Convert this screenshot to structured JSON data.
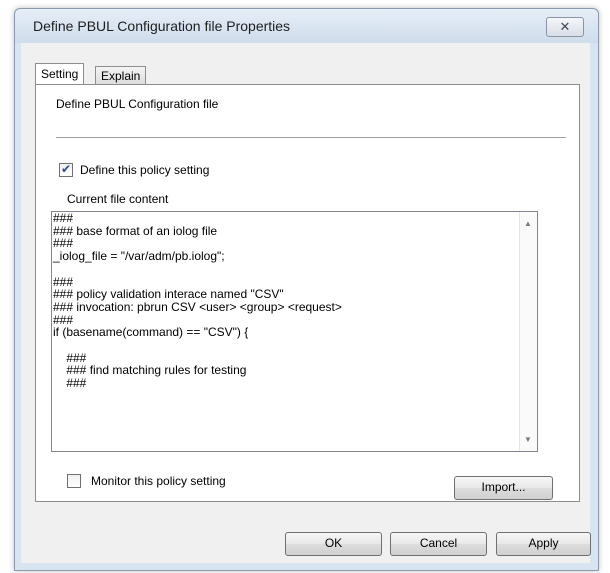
{
  "window": {
    "title": "Define PBUL Configuration file Properties",
    "close_glyph": "✕"
  },
  "tabs": [
    {
      "label": "Setting",
      "active": true
    },
    {
      "label": "Explain",
      "active": false
    }
  ],
  "setting": {
    "heading": "Define PBUL Configuration file",
    "define_checkbox": {
      "label": "Define this policy setting",
      "checked": true
    },
    "content_label": "Current file content",
    "file_content": "###\n### base format of an iolog file\n###\n_iolog_file = \"/var/adm/pb.iolog\";\n\n###\n### policy validation interace named \"CSV\"\n### invocation: pbrun CSV <user> <group> <request>\n###\nif (basename(command) == \"CSV\") {\n\n    ###\n    ### find matching rules for testing\n    ###",
    "monitor_checkbox": {
      "label": "Monitor this policy setting",
      "checked": false
    },
    "import_label": "Import..."
  },
  "footer": {
    "ok_label": "OK",
    "cancel_label": "Cancel",
    "apply_label": "Apply"
  }
}
